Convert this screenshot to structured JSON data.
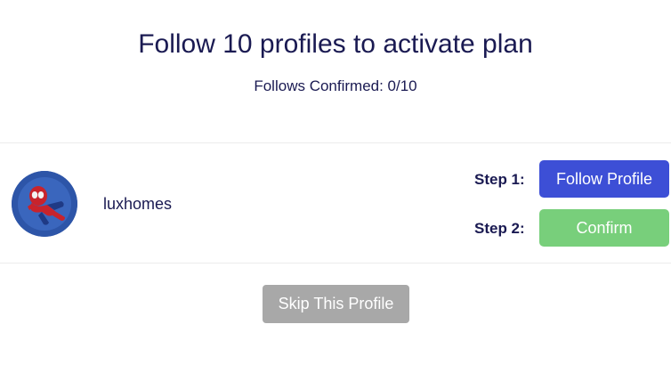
{
  "header": {
    "title": "Follow 10 profiles to activate plan",
    "follows_confirmed": "Follows Confirmed: 0/10"
  },
  "profile": {
    "username": "luxhomes",
    "avatar_icon": "spiderman-avatar-icon",
    "step1_label": "Step 1:",
    "step2_label": "Step 2:",
    "follow_button": "Follow Profile",
    "confirm_button": "Confirm"
  },
  "actions": {
    "skip_button": "Skip This Profile"
  },
  "colors": {
    "text": "#1a1a52",
    "follow_button": "#3d4fd6",
    "confirm_button": "#78cf7b",
    "skip_button": "#a8a8a8"
  }
}
